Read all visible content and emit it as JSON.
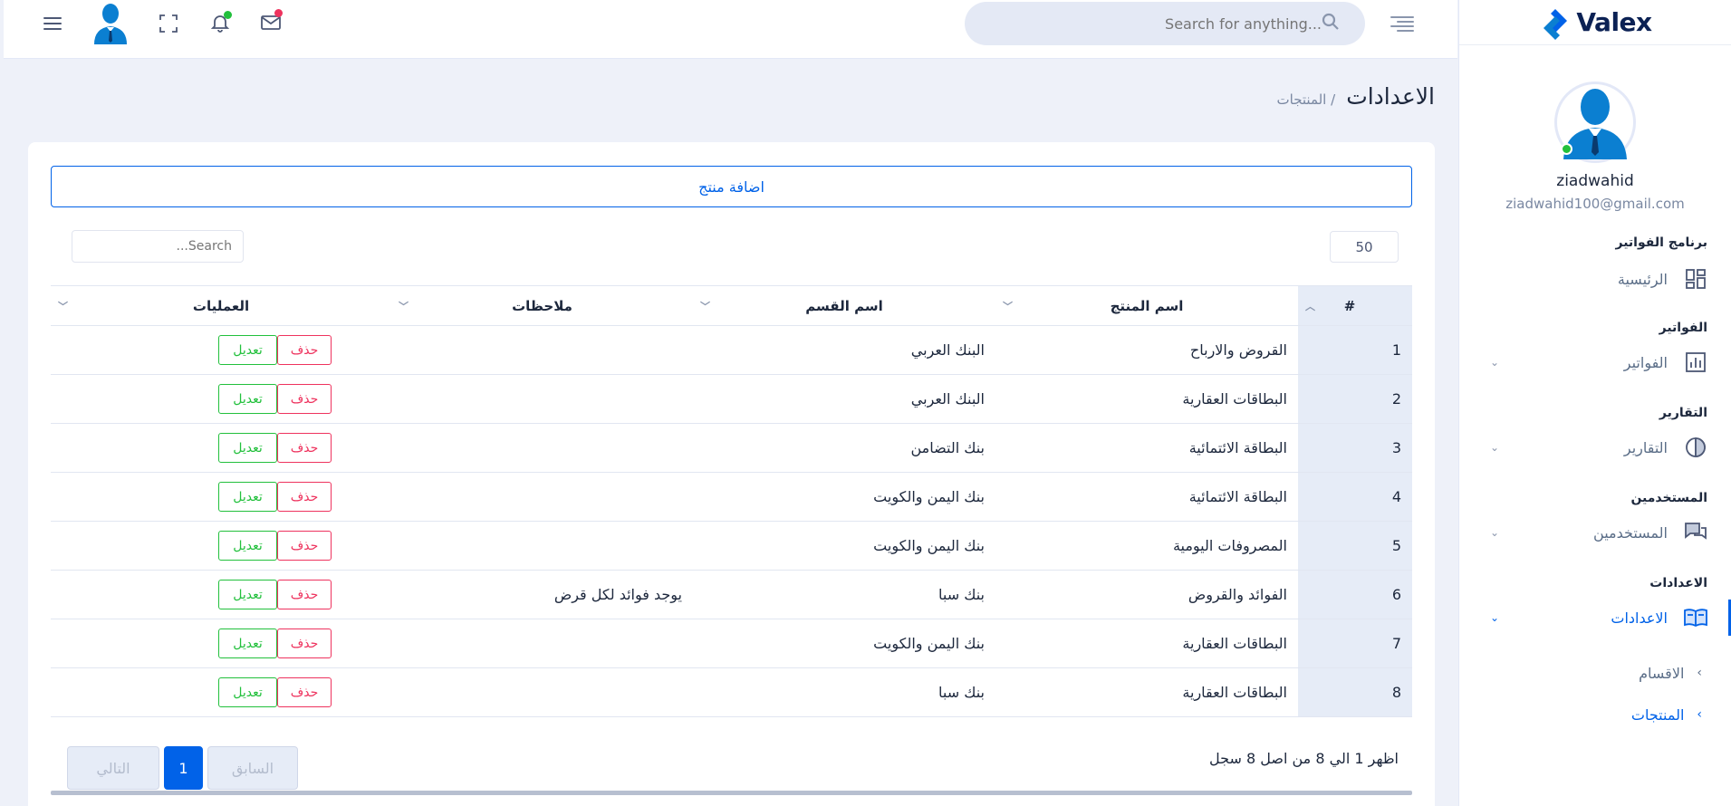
{
  "brand": {
    "name": "Valex"
  },
  "header": {
    "search_placeholder": "Search for anything..."
  },
  "profile": {
    "name": "ziadwahid",
    "email": "ziadwahid100@gmail.com"
  },
  "sidebar": {
    "sections": [
      {
        "category": "برنامج الفواتير",
        "item": "الرئيسية",
        "icon": "dashboard-icon",
        "has_chevron": false
      },
      {
        "category": "الفواتير",
        "item": "الفواتير",
        "icon": "chart-bar-icon",
        "has_chevron": true
      },
      {
        "category": "التقارير",
        "item": "التقارير",
        "icon": "pie-chart-icon",
        "has_chevron": true
      },
      {
        "category": "المستخدمين",
        "item": "المستخدمين",
        "icon": "chat-icon",
        "has_chevron": true
      },
      {
        "category": "الاعدادات",
        "item": "الاعدادات",
        "icon": "book-icon",
        "has_chevron": true
      }
    ],
    "sub_items": [
      "الاقسام",
      "المنتجات"
    ]
  },
  "page": {
    "title": "الاعدادات",
    "breadcrumb": "/ المنتجات"
  },
  "table": {
    "add_button": "اضافة منتج",
    "page_length": "50",
    "search_placeholder": "Search...",
    "columns": [
      "#",
      "اسم المنتج",
      "اسم القسم",
      "ملاحظات",
      "العمليات"
    ],
    "edit_label": "تعديل",
    "delete_label": "حذف",
    "rows": [
      {
        "num": "1",
        "product": "القروض والارباح",
        "section": "البنك العربي",
        "notes": ""
      },
      {
        "num": "2",
        "product": "البطاقات العقارية",
        "section": "البنك العربي",
        "notes": ""
      },
      {
        "num": "3",
        "product": "البطاقة الائتمائية",
        "section": "بنك التضامن",
        "notes": ""
      },
      {
        "num": "4",
        "product": "البطاقة الائتمائية",
        "section": "بنك اليمن والكويت",
        "notes": ""
      },
      {
        "num": "5",
        "product": "المصروفات اليومية",
        "section": "بنك اليمن والكويت",
        "notes": ""
      },
      {
        "num": "6",
        "product": "الفوائد والقروض",
        "section": "بنك سبا",
        "notes": "يوجد فوائد لكل قرض"
      },
      {
        "num": "7",
        "product": "البطاقات العقارية",
        "section": "بنك اليمن والكويت",
        "notes": ""
      },
      {
        "num": "8",
        "product": "البطاقات العقارية",
        "section": "بنك سبا",
        "notes": ""
      }
    ],
    "info": "اظهر 1 الي 8 من اصل 8 سجل",
    "pagination": {
      "prev": "السابق",
      "current": "1",
      "next": "التالي"
    }
  },
  "colors": {
    "accent": "#0162e8",
    "success": "#22c03c",
    "danger": "#ee335e",
    "online": "#22c03c",
    "notify": "#22c03c",
    "mail": "#ee335e"
  }
}
